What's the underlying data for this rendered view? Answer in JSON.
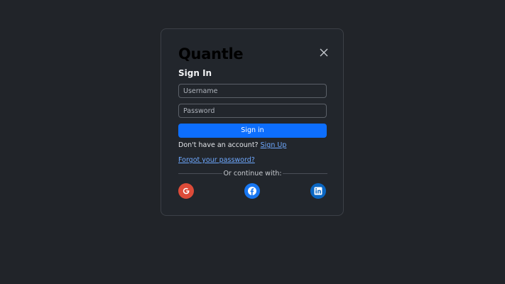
{
  "modal": {
    "logo": "Quantle",
    "title": "Sign In",
    "close_icon": "close-icon"
  },
  "form": {
    "username_placeholder": "Username",
    "password_placeholder": "Password",
    "submit_label": "Sign in"
  },
  "links": {
    "no_account_text": "Don't have an account?",
    "signup_label": "Sign Up",
    "forgot_label": "Forgot your password?"
  },
  "divider": {
    "text": "Or continue with:"
  },
  "social": [
    {
      "icon": "google-icon",
      "color": "#dd4b39"
    },
    {
      "icon": "facebook-icon",
      "color": "#1877f2"
    },
    {
      "icon": "linkedin-icon",
      "color": "#0a66c2"
    }
  ],
  "colors": {
    "background": "#212429",
    "primary": "#0d6efd",
    "link": "#6ea8fe"
  }
}
